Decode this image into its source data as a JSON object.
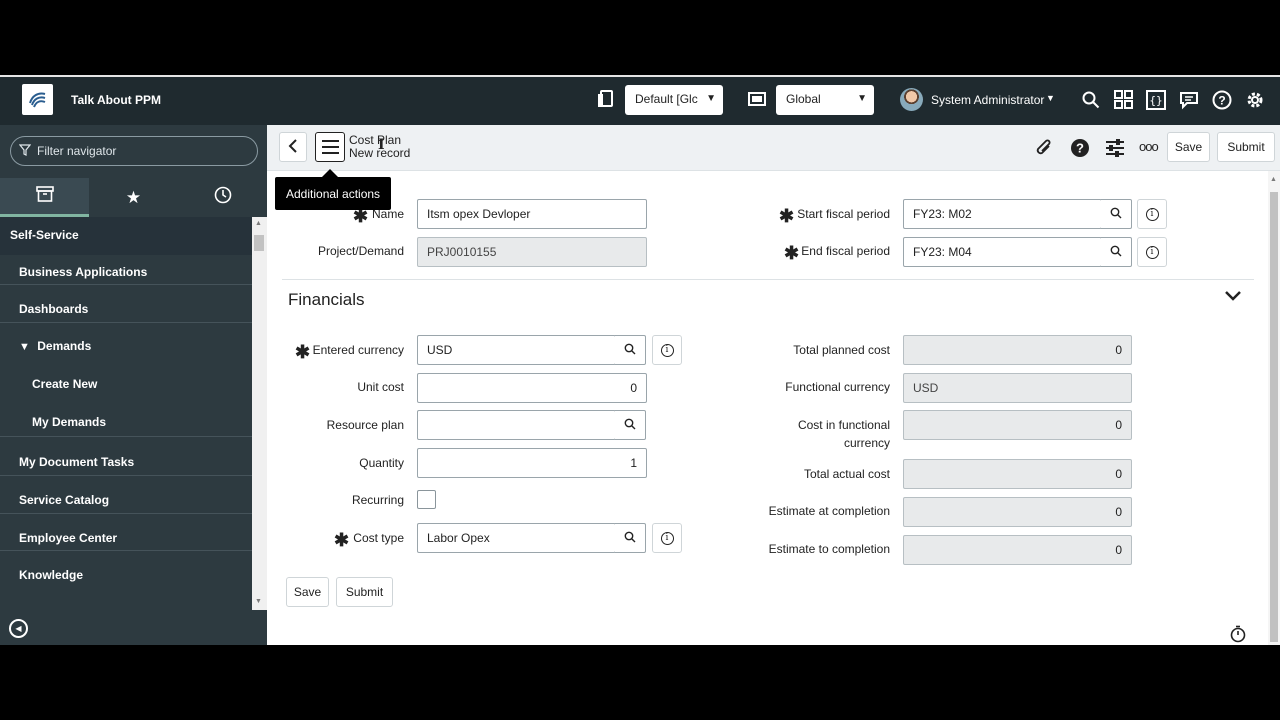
{
  "header": {
    "brand": "Talk About PPM",
    "icons": [
      "document-icon",
      "window-icon",
      "search-icon",
      "grid-icon",
      "braces-icon",
      "chat-icon",
      "help-icon",
      "gear-icon"
    ],
    "update_set_value": "Default [Glc",
    "scope_value": "Global",
    "user_name": "System Administrator"
  },
  "nav": {
    "filter_placeholder": "Filter navigator",
    "tabs": [
      "all-apps",
      "favorites",
      "history"
    ],
    "section": "Self-Service",
    "items": [
      {
        "label": "Business Applications",
        "level": 1
      },
      {
        "label": "Dashboards",
        "level": 1
      },
      {
        "label": "Demands",
        "level": 1,
        "expanded": true
      },
      {
        "label": "Create New",
        "level": 2
      },
      {
        "label": "My Demands",
        "level": 2
      },
      {
        "label": "My Document Tasks",
        "level": 1
      },
      {
        "label": "Service Catalog",
        "level": 1
      },
      {
        "label": "Employee Center",
        "level": 1
      },
      {
        "label": "Knowledge",
        "level": 1
      }
    ]
  },
  "form": {
    "table_name": "Cost Plan",
    "record_state": "New record",
    "tooltip": "Additional actions",
    "save_label": "Save",
    "submit_label": "Submit",
    "fields": {
      "name_label": "Name",
      "name_value": "Itsm opex Devloper",
      "project_label": "Project/Demand",
      "project_value": "PRJ0010155",
      "start_label": "Start fiscal period",
      "start_value": "FY23: M02",
      "end_label": "End fiscal period",
      "end_value": "FY23: M04"
    },
    "financials": {
      "title": "Financials",
      "entered_currency_label": "Entered currency",
      "entered_currency_value": "USD",
      "unit_cost_label": "Unit cost",
      "unit_cost_value": "0",
      "resource_plan_label": "Resource plan",
      "resource_plan_value": "",
      "quantity_label": "Quantity",
      "quantity_value": "1",
      "recurring_label": "Recurring",
      "cost_type_label": "Cost type",
      "cost_type_value": "Labor Opex",
      "total_planned_label": "Total planned cost",
      "total_planned_value": "0",
      "functional_currency_label": "Functional currency",
      "functional_currency_value": "USD",
      "cost_functional_label_1": "Cost in functional",
      "cost_functional_label_2": "currency",
      "cost_functional_value": "0",
      "total_actual_label": "Total actual cost",
      "total_actual_value": "0",
      "eac_label": "Estimate at completion",
      "eac_value": "0",
      "etc_label": "Estimate to completion",
      "etc_value": "0"
    }
  }
}
